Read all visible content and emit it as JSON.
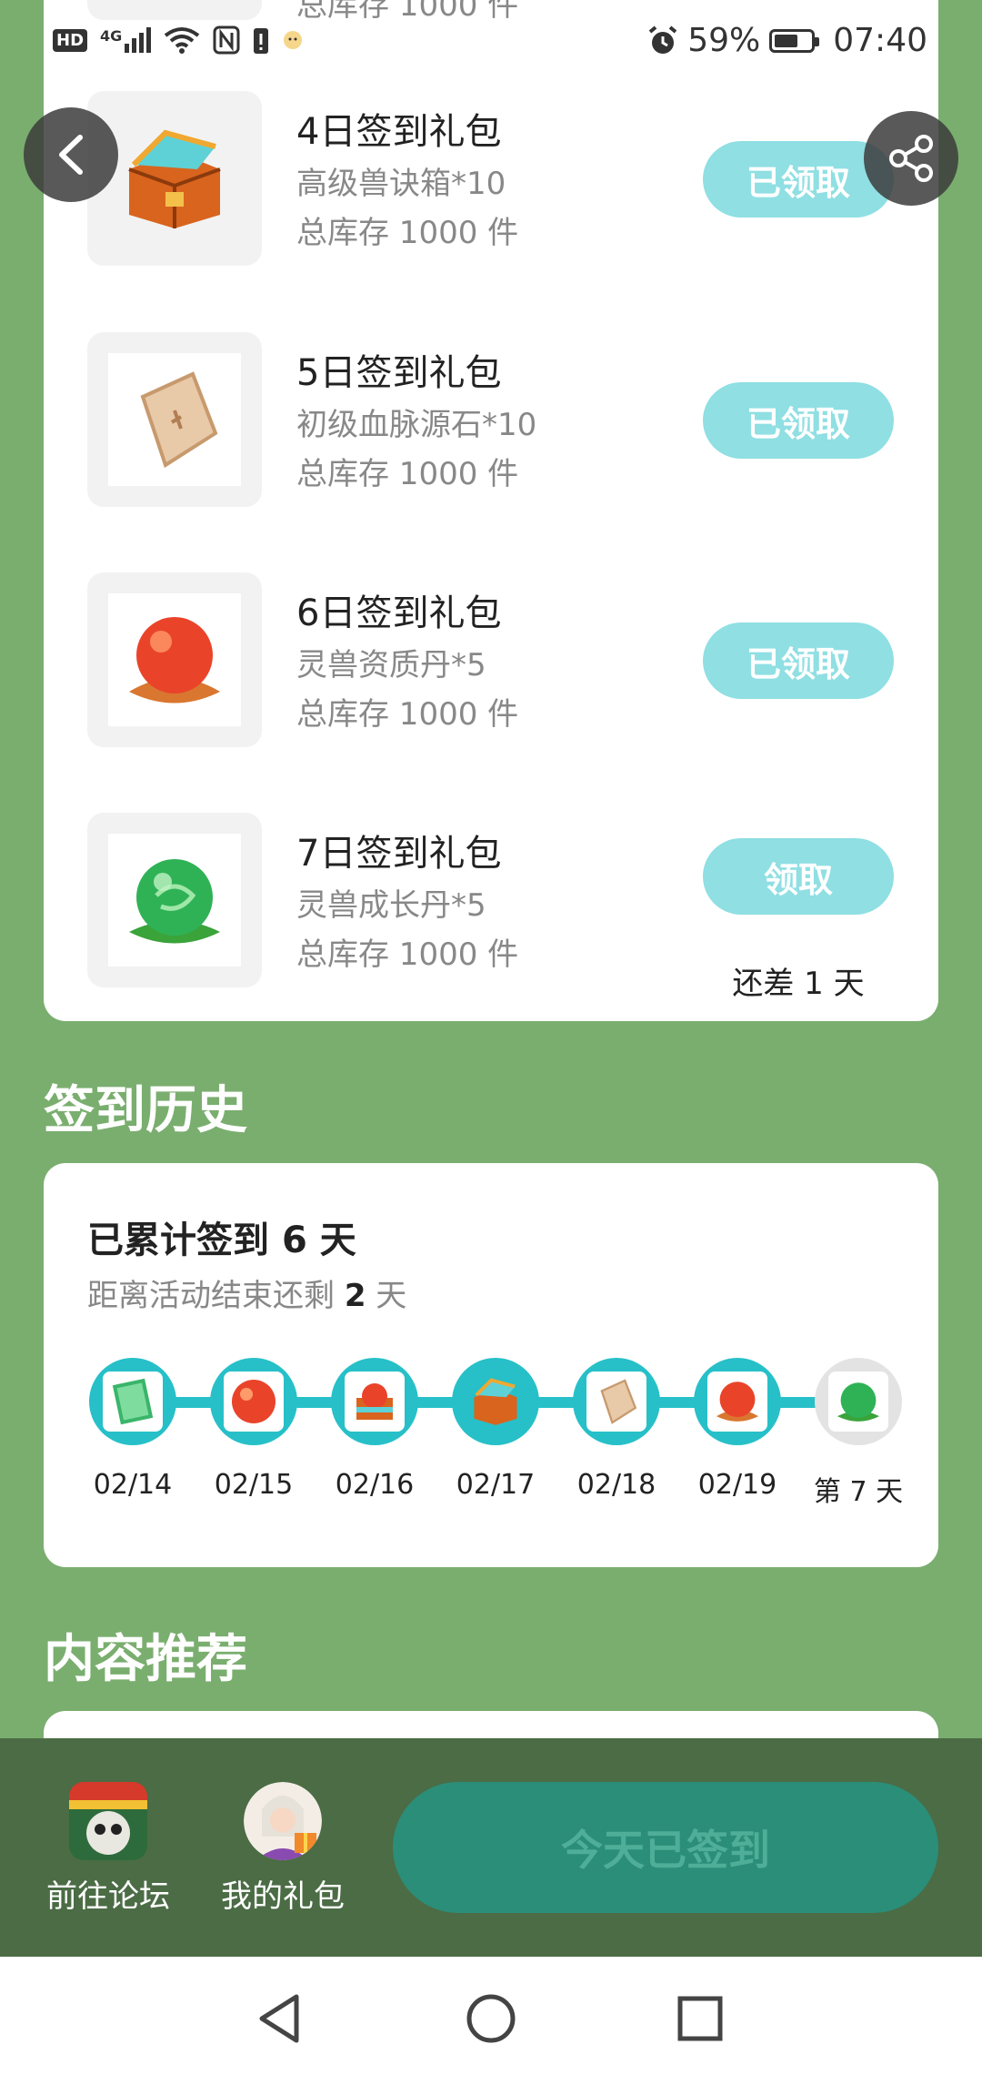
{
  "status_bar": {
    "hd": "HD",
    "signal_label": "4G",
    "battery": "59%",
    "time": "07:40"
  },
  "gifts": [
    {
      "title": "4日签到礼包",
      "desc": "高级兽诀箱*10",
      "stock": "总库存 1000 件",
      "button": "已领取",
      "icon": "treasure-chest-icon"
    },
    {
      "title": "5日签到礼包",
      "desc": "初级血脉源石*10",
      "stock": "总库存 1000 件",
      "button": "已领取",
      "icon": "stone-tile-icon"
    },
    {
      "title": "6日签到礼包",
      "desc": "灵兽资质丹*5",
      "stock": "总库存 1000 件",
      "button": "已领取",
      "icon": "red-orb-icon"
    },
    {
      "title": "7日签到礼包",
      "desc": "灵兽成长丹*5",
      "stock": "总库存 1000 件",
      "button": "领取",
      "note": "还差 1 天",
      "icon": "green-orb-icon"
    }
  ],
  "history": {
    "section_title": "签到历史",
    "total_prefix": "已累计签到 ",
    "total_days": "6",
    "total_suffix": " 天",
    "remain_prefix": "距离活动结束还剩 ",
    "remain_days": "2",
    "remain_suffix": " 天",
    "days": [
      {
        "label": "02/14",
        "icon": "book-icon"
      },
      {
        "label": "02/15",
        "icon": "red-orb-icon"
      },
      {
        "label": "02/16",
        "icon": "treasure-box-icon"
      },
      {
        "label": "02/17",
        "icon": "treasure-chest-icon"
      },
      {
        "label": "02/18",
        "icon": "stone-tile-icon"
      },
      {
        "label": "02/19",
        "icon": "red-orb-icon"
      },
      {
        "label": "第 7 天",
        "icon": "green-orb-icon"
      }
    ]
  },
  "recommend": {
    "section_title": "内容推荐"
  },
  "bottom_bar": {
    "forum_label": "前往论坛",
    "gifts_label": "我的礼包",
    "checkin_label": "今天已签到"
  },
  "colors": {
    "background": "#7aae6f",
    "accent": "#27c0c8",
    "button_disabled": "#8fdfe3",
    "bottom_bar": "#4b6c45",
    "checkin_button": "#2b8e79"
  }
}
